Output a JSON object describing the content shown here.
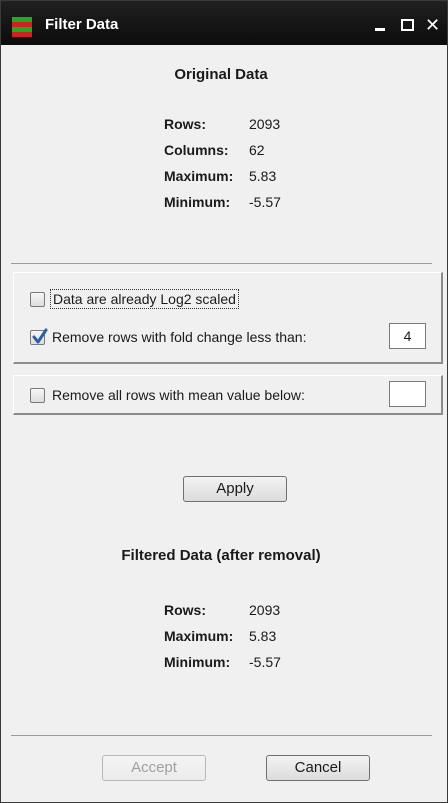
{
  "window": {
    "title": "Filter Data",
    "minimize_glyph": "",
    "maximize_glyph": "",
    "close_glyph": "✕"
  },
  "original": {
    "heading": "Original Data",
    "stats": [
      {
        "label": "Rows:",
        "value": "2093"
      },
      {
        "label": "Columns:",
        "value": "62"
      },
      {
        "label": "Maximum:",
        "value": "5.83"
      },
      {
        "label": "Minimum:",
        "value": "-5.57"
      }
    ]
  },
  "options": {
    "log2_label": "Data are already Log2 scaled",
    "log2_checked": false,
    "fold_label": "Remove rows with fold change less than:",
    "fold_checked": true,
    "fold_value": "4",
    "mean_label": "Remove all rows with mean value below:",
    "mean_checked": false,
    "mean_value": ""
  },
  "apply_label": "Apply",
  "filtered": {
    "heading": "Filtered Data (after removal)",
    "stats": [
      {
        "label": "Rows:",
        "value": "2093"
      },
      {
        "label": "Maximum:",
        "value": "5.83"
      },
      {
        "label": "Minimum:",
        "value": "-5.57"
      }
    ]
  },
  "footer": {
    "accept_label": "Accept",
    "cancel_label": "Cancel"
  },
  "colors": {
    "icon_green": "#22aa22",
    "icon_red": "#cc2222",
    "check_blue": "#2a5fa8"
  }
}
